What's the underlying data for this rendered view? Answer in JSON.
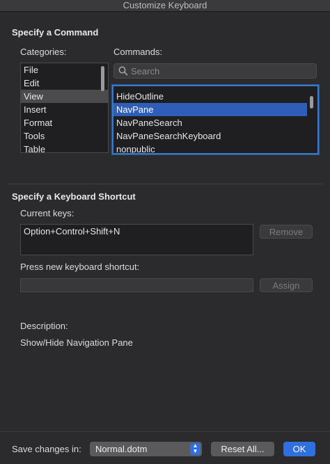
{
  "window": {
    "title": "Customize Keyboard"
  },
  "command_section": {
    "title": "Specify a Command",
    "categories_label": "Categories:",
    "categories": [
      "File",
      "Edit",
      "View",
      "Insert",
      "Format",
      "Tools",
      "Table"
    ],
    "categories_selected": "View",
    "commands_label": "Commands:",
    "search_placeholder": "Search",
    "commands": [
      "HideOutline",
      "NavPane",
      "NavPaneSearch",
      "NavPaneSearchKeyboard",
      "nonpublic"
    ],
    "commands_selected": "NavPane"
  },
  "shortcut_section": {
    "title": "Specify a Keyboard Shortcut",
    "current_keys_label": "Current keys:",
    "current_keys_value": "Option+Control+Shift+N",
    "remove_label": "Remove",
    "new_shortcut_label": "Press new keyboard shortcut:",
    "new_shortcut_value": "",
    "assign_label": "Assign",
    "description_label": "Description:",
    "description_text": "Show/Hide Navigation Pane"
  },
  "footer": {
    "save_changes_label": "Save changes in:",
    "save_changes_value": "Normal.dotm",
    "reset_all_label": "Reset All...",
    "ok_label": "OK"
  },
  "colors": {
    "selection_blue": "#2f5eb8",
    "primary_button": "#2f6fe0",
    "background": "#2b2a2d"
  },
  "icons": {
    "search": "magnifier-icon",
    "select": "up-down-arrows-icon"
  }
}
